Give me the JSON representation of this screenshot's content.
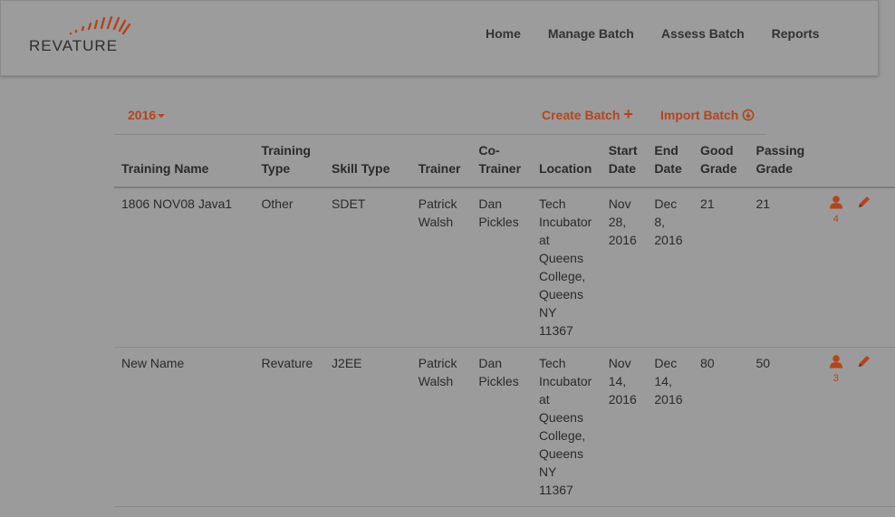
{
  "brand": {
    "name": "REVATURE",
    "accent": "#b4441c"
  },
  "nav": {
    "items": [
      {
        "label": "Home"
      },
      {
        "label": "Manage Batch"
      },
      {
        "label": "Assess Batch"
      },
      {
        "label": "Reports"
      }
    ]
  },
  "toolbar": {
    "year": "2016",
    "create_label": "Create Batch",
    "import_label": "Import Batch"
  },
  "table": {
    "headers": {
      "training_name": "Training Name",
      "training_type_1": "Training",
      "training_type_2": "Type",
      "skill_type": "Skill Type",
      "trainer": "Trainer",
      "co_trainer_1": "Co-",
      "co_trainer_2": "Trainer",
      "location": "Location",
      "start_1": "Start",
      "start_2": "Date",
      "end_1": "End",
      "end_2": "Date",
      "good_1": "Good",
      "good_2": "Grade",
      "passing_1": "Passing",
      "passing_2": "Grade"
    },
    "rows": [
      {
        "training_name": "1806 NOV08 Java1",
        "training_type": "Other",
        "skill_type": "SDET",
        "trainer_1": "Patrick",
        "trainer_2": "Walsh",
        "co_trainer_1": "Dan",
        "co_trainer_2": "Pickles",
        "location": [
          "Tech",
          "Incubator",
          "at",
          "Queens",
          "College,",
          "Queens",
          "NY",
          "11367"
        ],
        "start_1": "Nov",
        "start_2": "28,",
        "start_3": "2016",
        "end_1": "Dec",
        "end_2": "8,",
        "end_3": "2016",
        "good_grade": "21",
        "passing_grade": "21",
        "trainee_count": "4"
      },
      {
        "training_name": "New Name",
        "training_type": "Revature",
        "skill_type": "J2EE",
        "trainer_1": "Patrick",
        "trainer_2": "Walsh",
        "co_trainer_1": "Dan",
        "co_trainer_2": "Pickles",
        "location": [
          "Tech",
          "Incubator",
          "at",
          "Queens",
          "College,",
          "Queens",
          "NY",
          "11367"
        ],
        "start_1": "Nov",
        "start_2": "14,",
        "start_3": "2016",
        "end_1": "Dec",
        "end_2": "14,",
        "end_3": "2016",
        "good_grade": "80",
        "passing_grade": "50",
        "trainee_count": "3"
      }
    ]
  }
}
